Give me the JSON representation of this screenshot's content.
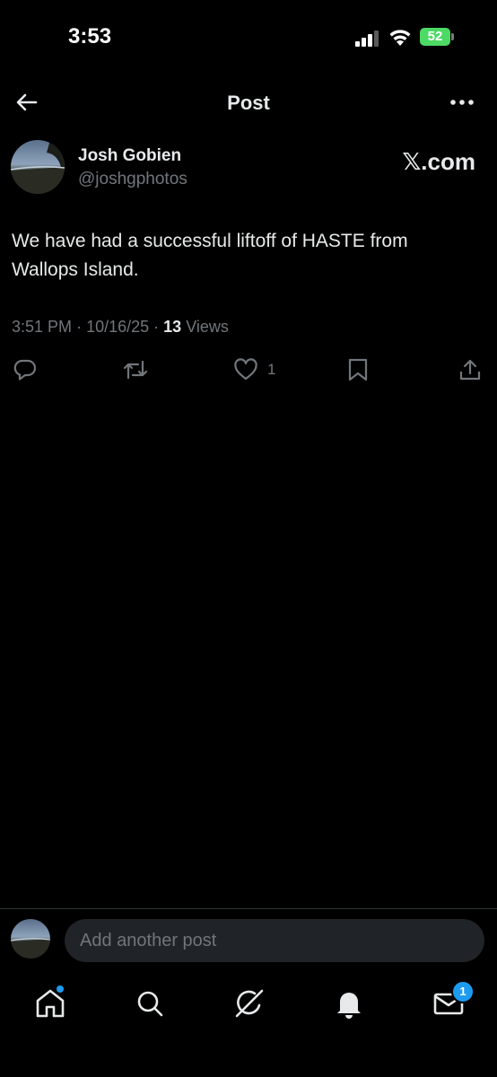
{
  "status_bar": {
    "time": "3:53",
    "battery": "52",
    "icons": [
      "signal-icon",
      "wifi-icon",
      "battery-icon"
    ]
  },
  "header": {
    "title": "Post",
    "back_icon": "arrow-left-icon",
    "more_icon": "more-icon"
  },
  "post": {
    "author_name": "Josh Gobien",
    "author_handle": "@joshgphotos",
    "source": "𝕏.com",
    "text": "We have had a successful liftoff of HASTE from Wallops Island.",
    "time": "3:51 PM",
    "date": "10/16/25",
    "views_count": "13",
    "views_label": "Views",
    "actions": {
      "reply_icon": "reply-icon",
      "repost_icon": "repost-icon",
      "like_icon": "heart-icon",
      "like_count": "1",
      "bookmark_icon": "bookmark-icon",
      "share_icon": "share-icon"
    }
  },
  "composer": {
    "placeholder": "Add another post"
  },
  "tab_bar": {
    "items": [
      {
        "name": "home",
        "icon": "home-icon",
        "has_dot": true
      },
      {
        "name": "search",
        "icon": "search-icon"
      },
      {
        "name": "grok",
        "icon": "grok-icon"
      },
      {
        "name": "notifications",
        "icon": "bell-icon"
      },
      {
        "name": "messages",
        "icon": "mail-icon",
        "badge": "1"
      }
    ]
  },
  "colors": {
    "background": "#000000",
    "text_primary": "#e7e9ea",
    "text_secondary": "#71767b",
    "accent": "#1d9bf0",
    "battery": "#4cd964"
  }
}
